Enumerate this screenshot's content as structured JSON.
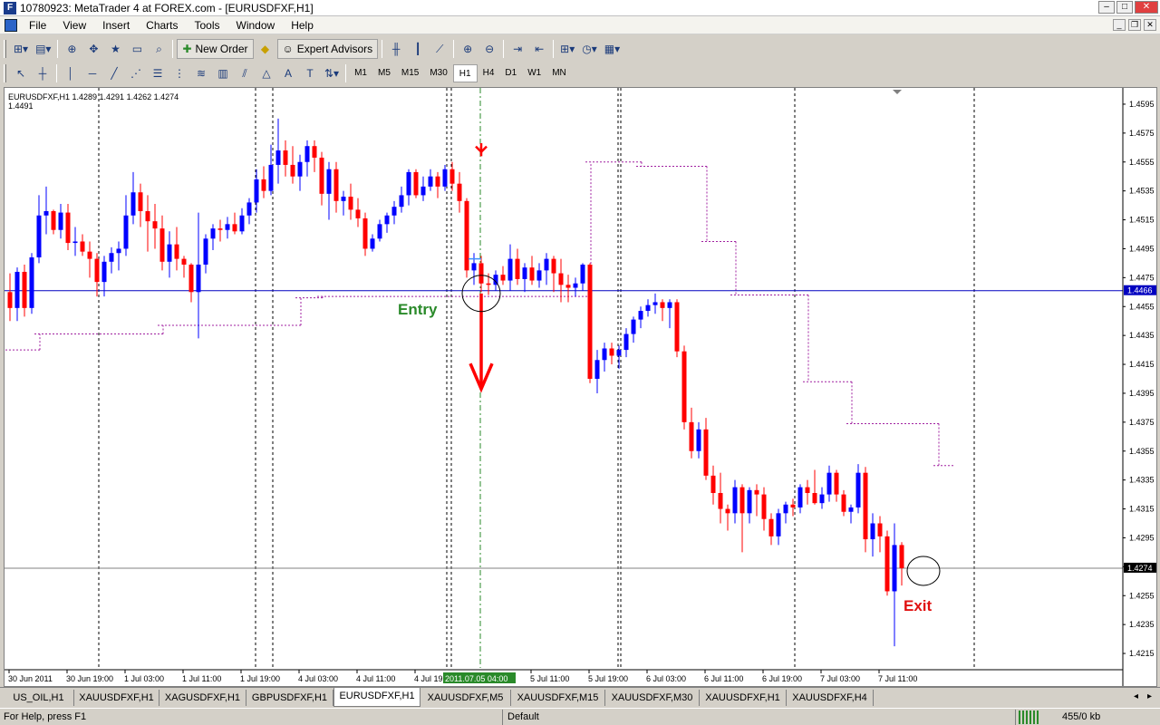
{
  "window": {
    "title": "10780923: MetaTrader 4 at FOREX.com - [EURUSDFXF,H1]"
  },
  "menu": [
    "File",
    "View",
    "Insert",
    "Charts",
    "Tools",
    "Window",
    "Help"
  ],
  "toolbar": {
    "new_order": "New Order",
    "expert_advisors": "Expert Advisors"
  },
  "timeframes": [
    "M1",
    "M5",
    "M15",
    "M30",
    "H1",
    "H4",
    "D1",
    "W1",
    "MN"
  ],
  "active_timeframe": "H1",
  "chart": {
    "header_line1": "EURUSDFXF,H1  1.4289 1.4291 1.4262 1.4274",
    "header_line2": "1.4491",
    "entry_label": "Entry",
    "exit_label": "Exit",
    "price_labels": [
      "1.4595",
      "1.4575",
      "1.4555",
      "1.4535",
      "1.4515",
      "1.4495",
      "1.4475",
      "1.4455",
      "1.4435",
      "1.4415",
      "1.4395",
      "1.4375",
      "1.4355",
      "1.4335",
      "1.4315",
      "1.4295",
      "1.4275",
      "1.4255",
      "1.4235",
      "1.4215"
    ],
    "hline_blue_price": "1.4466",
    "current_price": "1.4274",
    "time_labels": [
      "30 Jun 2011",
      "30 Jun 19:00",
      "1 Jul 03:00",
      "1 Jul 11:00",
      "1 Jul 19:00",
      "4 Jul 03:00",
      "4 Jul 11:00",
      "4 Jul 19",
      "5 Jul 11:00",
      "5 Jul 19:00",
      "6 Jul 03:00",
      "6 Jul 11:00",
      "6 Jul 19:00",
      "7 Jul 03:00",
      "7 Jul 11:00"
    ],
    "cursor_time": "2011.07.05 04:00",
    "colors": {
      "bull": "#0000ff",
      "bear": "#ff0000",
      "sar": "#a020a0",
      "hline": "#0000c0",
      "entry": "#2a8a2a",
      "exit": "#e01010"
    }
  },
  "chart_data": {
    "type": "candlestick",
    "symbol": "EURUSDFXF",
    "timeframe": "H1",
    "ylim": [
      1.4205,
      1.4605
    ],
    "ohlc": [
      [
        1.4465,
        1.4478,
        1.4445,
        1.4454
      ],
      [
        1.4454,
        1.4482,
        1.4445,
        1.4479
      ],
      [
        1.4479,
        1.4484,
        1.4448,
        1.4454
      ],
      [
        1.4454,
        1.4492,
        1.445,
        1.4489
      ],
      [
        1.4489,
        1.4532,
        1.4485,
        1.4518
      ],
      [
        1.4518,
        1.4538,
        1.4505,
        1.4521
      ],
      [
        1.4521,
        1.4522,
        1.4505,
        1.4508
      ],
      [
        1.4508,
        1.4526,
        1.4502,
        1.452
      ],
      [
        1.452,
        1.4526,
        1.4494,
        1.4499
      ],
      [
        1.4499,
        1.451,
        1.449,
        1.45
      ],
      [
        1.45,
        1.4505,
        1.449,
        1.4493
      ],
      [
        1.4493,
        1.45,
        1.4475,
        1.4488
      ],
      [
        1.4488,
        1.4492,
        1.4462,
        1.4472
      ],
      [
        1.4472,
        1.449,
        1.4462,
        1.4486
      ],
      [
        1.4486,
        1.4496,
        1.4478,
        1.4492
      ],
      [
        1.4492,
        1.45,
        1.448,
        1.4495
      ],
      [
        1.4495,
        1.4532,
        1.449,
        1.4518
      ],
      [
        1.4518,
        1.4548,
        1.4512,
        1.4534
      ],
      [
        1.4534,
        1.454,
        1.451,
        1.4521
      ],
      [
        1.4521,
        1.4532,
        1.4493,
        1.4514
      ],
      [
        1.4514,
        1.4526,
        1.4495,
        1.4509
      ],
      [
        1.4509,
        1.4518,
        1.448,
        1.4486
      ],
      [
        1.4486,
        1.4507,
        1.4475,
        1.4498
      ],
      [
        1.4498,
        1.451,
        1.448,
        1.4488
      ],
      [
        1.4488,
        1.449,
        1.4475,
        1.4484
      ],
      [
        1.4484,
        1.4485,
        1.4458,
        1.4465
      ],
      [
        1.4465,
        1.452,
        1.4433,
        1.4484
      ],
      [
        1.4484,
        1.4505,
        1.4478,
        1.4502
      ],
      [
        1.4502,
        1.4512,
        1.4494,
        1.4509
      ],
      [
        1.4509,
        1.4515,
        1.45,
        1.4508
      ],
      [
        1.4508,
        1.4517,
        1.4502,
        1.4512
      ],
      [
        1.4512,
        1.452,
        1.4505,
        1.4507
      ],
      [
        1.4507,
        1.4523,
        1.4505,
        1.4518
      ],
      [
        1.4518,
        1.453,
        1.4512,
        1.4527
      ],
      [
        1.4527,
        1.455,
        1.452,
        1.4543
      ],
      [
        1.4543,
        1.4552,
        1.453,
        1.4535
      ],
      [
        1.4535,
        1.4567,
        1.4532,
        1.4553
      ],
      [
        1.4553,
        1.4585,
        1.454,
        1.4563
      ],
      [
        1.4563,
        1.457,
        1.4545,
        1.4553
      ],
      [
        1.4553,
        1.4566,
        1.454,
        1.4545
      ],
      [
        1.4545,
        1.456,
        1.4535,
        1.4555
      ],
      [
        1.4555,
        1.457,
        1.4545,
        1.4566
      ],
      [
        1.4566,
        1.457,
        1.4548,
        1.4558
      ],
      [
        1.4558,
        1.4562,
        1.4525,
        1.4533
      ],
      [
        1.4533,
        1.4555,
        1.4515,
        1.455
      ],
      [
        1.455,
        1.4555,
        1.452,
        1.4528
      ],
      [
        1.4528,
        1.4535,
        1.4518,
        1.4531
      ],
      [
        1.4531,
        1.454,
        1.4515,
        1.4522
      ],
      [
        1.4522,
        1.453,
        1.451,
        1.4516
      ],
      [
        1.4516,
        1.452,
        1.449,
        1.4495
      ],
      [
        1.4495,
        1.4505,
        1.4493,
        1.4502
      ],
      [
        1.4502,
        1.4515,
        1.45,
        1.4512
      ],
      [
        1.4512,
        1.452,
        1.4506,
        1.4518
      ],
      [
        1.4518,
        1.4528,
        1.4512,
        1.4524
      ],
      [
        1.4524,
        1.4538,
        1.452,
        1.4532
      ],
      [
        1.4532,
        1.455,
        1.4525,
        1.4548
      ],
      [
        1.4548,
        1.455,
        1.453,
        1.4532
      ],
      [
        1.4532,
        1.4545,
        1.4528,
        1.4538
      ],
      [
        1.4538,
        1.455,
        1.4535,
        1.4545
      ],
      [
        1.4545,
        1.4548,
        1.453,
        1.4538
      ],
      [
        1.4538,
        1.4553,
        1.4535,
        1.455
      ],
      [
        1.455,
        1.4555,
        1.4535,
        1.454
      ],
      [
        1.454,
        1.4548,
        1.452,
        1.4528
      ],
      [
        1.4528,
        1.453,
        1.4475,
        1.448
      ],
      [
        1.448,
        1.4492,
        1.447,
        1.4485
      ],
      [
        1.4485,
        1.449,
        1.4465,
        1.4471
      ],
      [
        1.4471,
        1.4478,
        1.4463,
        1.447
      ],
      [
        1.447,
        1.448,
        1.4466,
        1.4477
      ],
      [
        1.4477,
        1.4483,
        1.447,
        1.4473
      ],
      [
        1.4473,
        1.4498,
        1.4466,
        1.4488
      ],
      [
        1.4488,
        1.4495,
        1.447,
        1.4474
      ],
      [
        1.4474,
        1.4485,
        1.4465,
        1.4482
      ],
      [
        1.4482,
        1.449,
        1.447,
        1.4473
      ],
      [
        1.4473,
        1.4485,
        1.4468,
        1.448
      ],
      [
        1.448,
        1.4492,
        1.447,
        1.4488
      ],
      [
        1.4488,
        1.449,
        1.4465,
        1.4478
      ],
      [
        1.4478,
        1.4488,
        1.4458,
        1.447
      ],
      [
        1.447,
        1.4477,
        1.4458,
        1.4468
      ],
      [
        1.4468,
        1.4475,
        1.4462,
        1.4471
      ],
      [
        1.4471,
        1.4485,
        1.4466,
        1.4484
      ],
      [
        1.4484,
        1.4485,
        1.4402,
        1.4405
      ],
      [
        1.4405,
        1.4425,
        1.4395,
        1.4418
      ],
      [
        1.4418,
        1.443,
        1.441,
        1.4426
      ],
      [
        1.4426,
        1.443,
        1.4415,
        1.4421
      ],
      [
        1.4421,
        1.4428,
        1.4412,
        1.4425
      ],
      [
        1.4425,
        1.444,
        1.442,
        1.4436
      ],
      [
        1.4436,
        1.4448,
        1.443,
        1.4446
      ],
      [
        1.4446,
        1.4455,
        1.444,
        1.4452
      ],
      [
        1.4452,
        1.446,
        1.4448,
        1.4456
      ],
      [
        1.4456,
        1.4464,
        1.445,
        1.4458
      ],
      [
        1.4458,
        1.446,
        1.4445,
        1.4454
      ],
      [
        1.4454,
        1.446,
        1.444,
        1.4458
      ],
      [
        1.4458,
        1.446,
        1.442,
        1.4424
      ],
      [
        1.4424,
        1.4428,
        1.437,
        1.4375
      ],
      [
        1.4375,
        1.4385,
        1.435,
        1.4355
      ],
      [
        1.4355,
        1.4375,
        1.435,
        1.437
      ],
      [
        1.437,
        1.4378,
        1.4335,
        1.4338
      ],
      [
        1.4338,
        1.4345,
        1.4318,
        1.4326
      ],
      [
        1.4326,
        1.434,
        1.4305,
        1.4315
      ],
      [
        1.4315,
        1.4318,
        1.43,
        1.4312
      ],
      [
        1.4312,
        1.4335,
        1.4305,
        1.433
      ],
      [
        1.433,
        1.4332,
        1.4285,
        1.4312
      ],
      [
        1.4312,
        1.433,
        1.4305,
        1.4328
      ],
      [
        1.4328,
        1.4332,
        1.431,
        1.4325
      ],
      [
        1.4325,
        1.433,
        1.43,
        1.4308
      ],
      [
        1.4308,
        1.4312,
        1.429,
        1.4296
      ],
      [
        1.4296,
        1.4315,
        1.429,
        1.4312
      ],
      [
        1.4312,
        1.432,
        1.4305,
        1.4318
      ],
      [
        1.4318,
        1.4322,
        1.431,
        1.4316
      ],
      [
        1.4316,
        1.4332,
        1.4312,
        1.433
      ],
      [
        1.433,
        1.4335,
        1.4318,
        1.4326
      ],
      [
        1.4326,
        1.4342,
        1.4318,
        1.4319
      ],
      [
        1.4319,
        1.433,
        1.4315,
        1.4325
      ],
      [
        1.4325,
        1.4345,
        1.432,
        1.434
      ],
      [
        1.434,
        1.4342,
        1.432,
        1.4325
      ],
      [
        1.4325,
        1.4328,
        1.431,
        1.4313
      ],
      [
        1.4313,
        1.4318,
        1.4305,
        1.4316
      ],
      [
        1.4316,
        1.4346,
        1.4312,
        1.434
      ],
      [
        1.434,
        1.4344,
        1.4285,
        1.4294
      ],
      [
        1.4294,
        1.4312,
        1.4282,
        1.4305
      ],
      [
        1.4305,
        1.431,
        1.4285,
        1.4296
      ],
      [
        1.4296,
        1.43,
        1.4255,
        1.4258
      ],
      [
        1.4258,
        1.4305,
        1.422,
        1.429
      ],
      [
        1.429,
        1.4292,
        1.4262,
        1.4274
      ]
    ],
    "sar_levels": [
      {
        "from": 0,
        "to": 4,
        "price": 1.4425
      },
      {
        "from": 4,
        "to": 21,
        "price": 1.4436
      },
      {
        "from": 21,
        "to": 40,
        "price": 1.4442
      },
      {
        "from": 40,
        "to": 43,
        "price": 1.4461
      },
      {
        "from": 43,
        "to": 80,
        "price": 1.4462
      },
      {
        "from": 80,
        "to": 87,
        "price": 1.4555
      },
      {
        "from": 87,
        "to": 96,
        "price": 1.4552
      },
      {
        "from": 96,
        "to": 100,
        "price": 1.45
      },
      {
        "from": 100,
        "to": 110,
        "price": 1.4463
      },
      {
        "from": 110,
        "to": 116,
        "price": 1.4403
      },
      {
        "from": 116,
        "to": 128,
        "price": 1.4374
      },
      {
        "from": 128,
        "to": 130,
        "price": 1.4345
      }
    ]
  },
  "tabs": [
    "US_OIL,H1",
    "XAUUSDFXF,H1",
    "XAGUSDFXF,H1",
    "GBPUSDFXF,H1",
    "EURUSDFXF,H1",
    "XAUUSDFXF,M5",
    "XAUUSDFXF,M15",
    "XAUUSDFXF,M30",
    "XAUUSDFXF,H1",
    "XAUUSDFXF,H4"
  ],
  "active_tab": "EURUSDFXF,H1",
  "status": {
    "help": "For Help, press F1",
    "profile": "Default",
    "traffic": "455/0 kb"
  }
}
